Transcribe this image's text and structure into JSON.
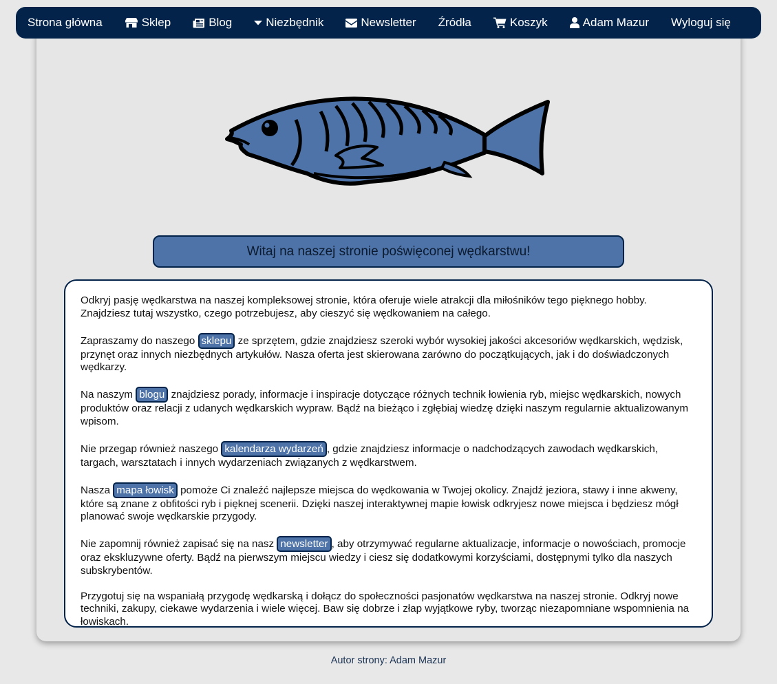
{
  "nav": {
    "home": "Strona główna",
    "shop": "Sklep",
    "blog": "Blog",
    "essentials": "Niezbędnik",
    "newsletter": "Newsletter",
    "sources": "Źródła",
    "cart": "Koszyk",
    "user": "Adam Mazur",
    "logout": "Wyloguj się"
  },
  "logo": {
    "icon": "fish-icon",
    "color": "#4e73a8"
  },
  "welcome": "Witaj na naszej stronie poświęconej wędkarstwu!",
  "content": {
    "p1": "Odkryj pasję wędkarstwa na naszej kompleksowej stronie, która oferuje wiele atrakcji dla miłośników tego pięknego hobby. Znajdziesz tutaj wszystko, czego potrzebujesz, aby cieszyć się wędkowaniem na całego.",
    "p2_before": "Zapraszamy do naszego ",
    "p2_link": "sklepu",
    "p2_after": " ze sprzętem, gdzie znajdziesz szeroki wybór wysokiej jakości akcesoriów wędkarskich, wędzisk, przynęt oraz innych niezbędnych artykułów. Nasza oferta jest skierowana zarówno do początkujących, jak i do doświadczonych wędkarzy.",
    "p3_before": "Na naszym ",
    "p3_link": "blogu",
    "p3_after": " znajdziesz porady, informacje i inspiracje dotyczące różnych technik łowienia ryb, miejsc wędkarskich, nowych produktów oraz relacji z udanych wędkarskich wypraw. Bądź na bieżąco i zgłębiaj wiedzę dzięki naszym regularnie aktualizowanym wpisom.",
    "p4_before": "Nie przegap również naszego ",
    "p4_link": "kalendarza wydarzeń",
    "p4_after": ", gdzie znajdziesz informacje o nadchodzących zawodach wędkarskich, targach, warsztatach i innych wydarzeniach związanych z wędkarstwem.",
    "p5_before": "Nasza ",
    "p5_link": "mapa łowisk",
    "p5_after": " pomoże Ci znaleźć najlepsze miejsca do wędkowania w Twojej okolicy. Znajdź jeziora, stawy i inne akweny, które są znane z obfitości ryb i pięknej scenerii. Dzięki naszej interaktywnej mapie łowisk odkryjesz nowe miejsca i będziesz mógł planować swoje wędkarskie przygody.",
    "p6_before": "Nie zapomnij również zapisać się na nasz ",
    "p6_link": "newsletter",
    "p6_after": ", aby otrzymywać regularne aktualizacje, informacje o nowościach, promocje oraz ekskluzywne oferty. Bądź na pierwszym miejscu wiedzy i ciesz się dodatkowymi korzyściami, dostępnymi tylko dla naszych subskrybentów.",
    "p7": "Przygotuj się na wspaniałą przygodę wędkarską i dołącz do społeczności pasjonatów wędkarstwa na naszej stronie. Odkryj nowe techniki, zakupy, ciekawe wydarzenia i wiele więcej. Baw się dobrze i złap wyjątkowe ryby, tworząc niezapomniane wspomnienia na łowiskach."
  },
  "footer": "Autor strony: Adam Mazur",
  "colors": {
    "nav_bg": "#03234a",
    "accent": "#4e73a8",
    "page_bg": "#e8e8e8"
  }
}
